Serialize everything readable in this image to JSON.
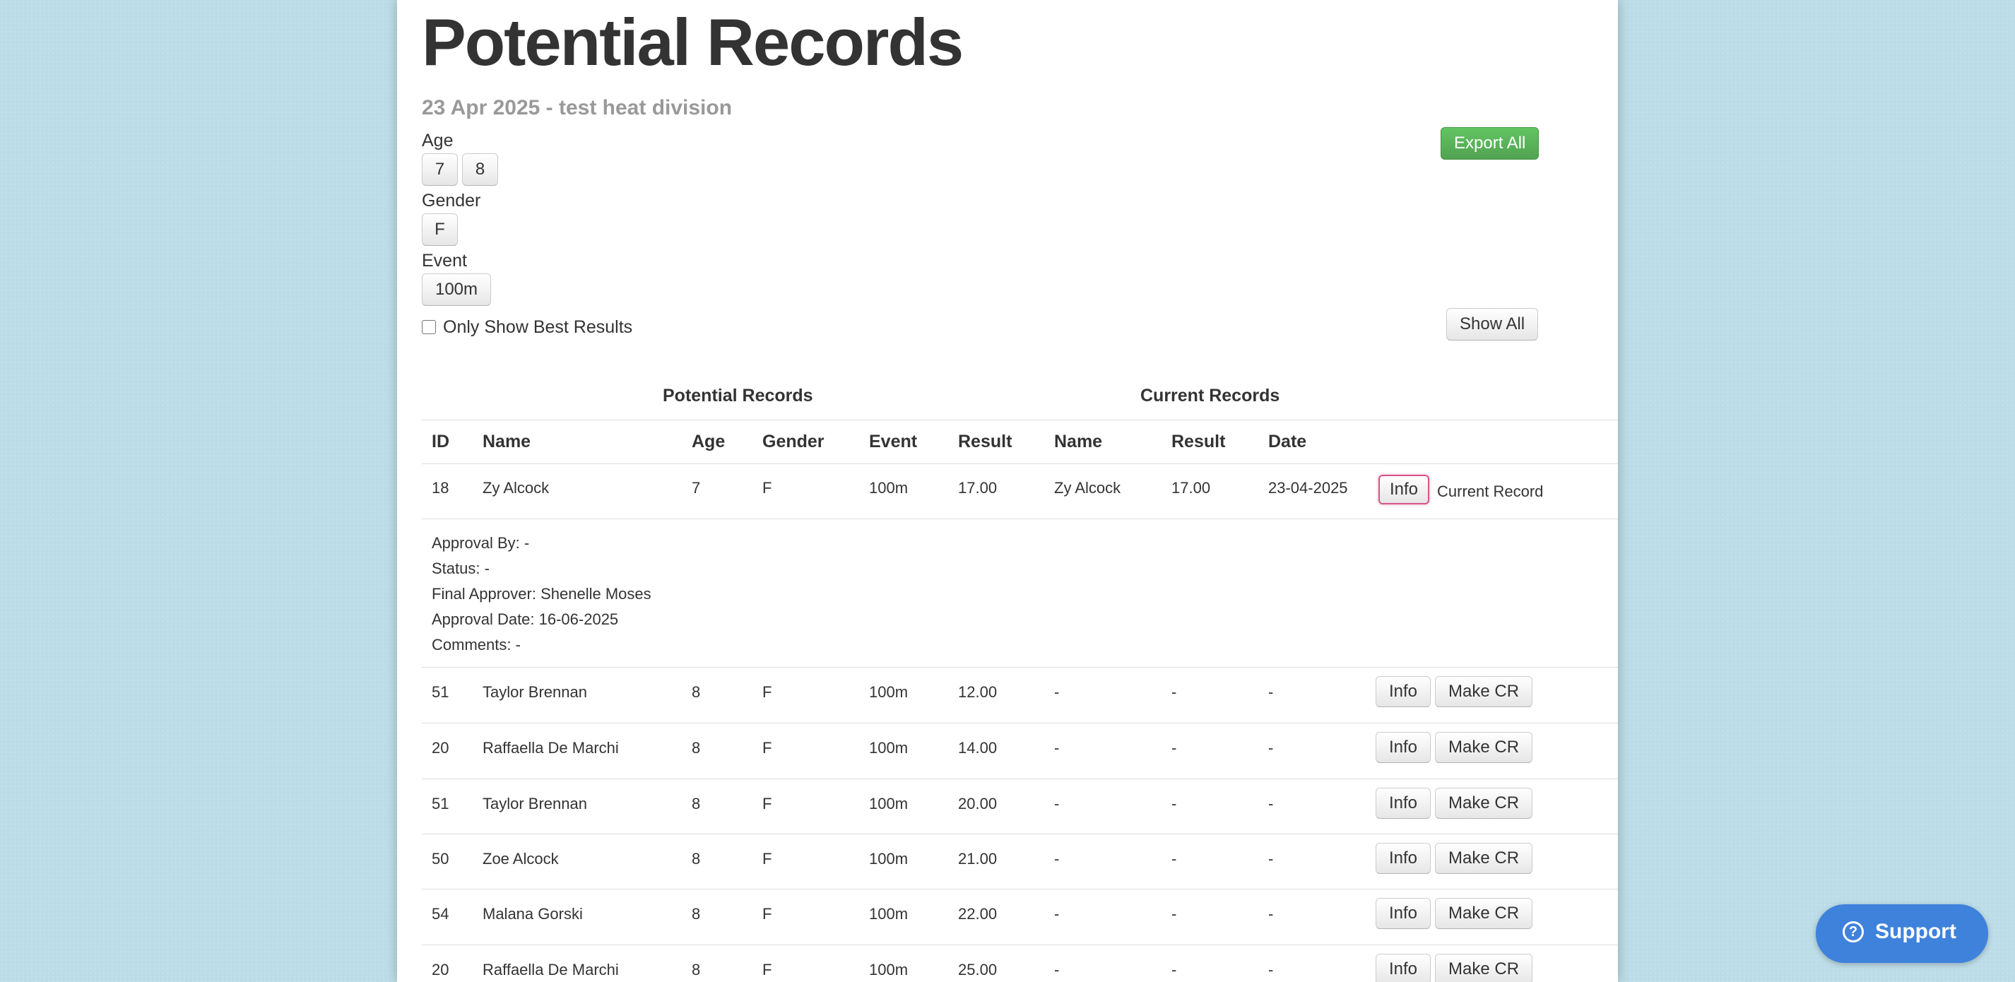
{
  "page": {
    "title": "Potential Records",
    "subtitle": "23 Apr 2025 - test heat division",
    "export_label": "Export All",
    "show_all_label": "Show All"
  },
  "filters": {
    "age": {
      "label": "Age",
      "options": [
        "7",
        "8"
      ]
    },
    "gender": {
      "label": "Gender",
      "options": [
        "F"
      ]
    },
    "event": {
      "label": "Event",
      "options": [
        "100m"
      ]
    },
    "best_only": {
      "label": "Only Show Best Results",
      "checked": false
    }
  },
  "table": {
    "group_headers": [
      "Potential Records",
      "Current Records"
    ],
    "columns": [
      "ID",
      "Name",
      "Age",
      "Gender",
      "Event",
      "Result",
      "Name",
      "Result",
      "Date"
    ],
    "info_label": "Info",
    "make_cr_label": "Make CR",
    "current_record_label": "Current Record",
    "rows": [
      {
        "id": "18",
        "name": "Zy Alcock",
        "age": "7",
        "gender": "F",
        "event": "100m",
        "result": "17.00",
        "cr_name": "Zy Alcock",
        "cr_result": "17.00",
        "cr_date": "23-04-2025",
        "is_current": true
      },
      {
        "id": "51",
        "name": "Taylor Brennan",
        "age": "8",
        "gender": "F",
        "event": "100m",
        "result": "12.00",
        "cr_name": "-",
        "cr_result": "-",
        "cr_date": "-",
        "is_current": false
      },
      {
        "id": "20",
        "name": "Raffaella De Marchi",
        "age": "8",
        "gender": "F",
        "event": "100m",
        "result": "14.00",
        "cr_name": "-",
        "cr_result": "-",
        "cr_date": "-",
        "is_current": false
      },
      {
        "id": "51",
        "name": "Taylor Brennan",
        "age": "8",
        "gender": "F",
        "event": "100m",
        "result": "20.00",
        "cr_name": "-",
        "cr_result": "-",
        "cr_date": "-",
        "is_current": false
      },
      {
        "id": "50",
        "name": "Zoe Alcock",
        "age": "8",
        "gender": "F",
        "event": "100m",
        "result": "21.00",
        "cr_name": "-",
        "cr_result": "-",
        "cr_date": "-",
        "is_current": false
      },
      {
        "id": "54",
        "name": "Malana Gorski",
        "age": "8",
        "gender": "F",
        "event": "100m",
        "result": "22.00",
        "cr_name": "-",
        "cr_result": "-",
        "cr_date": "-",
        "is_current": false
      },
      {
        "id": "20",
        "name": "Raffaella De Marchi",
        "age": "8",
        "gender": "F",
        "event": "100m",
        "result": "25.00",
        "cr_name": "-",
        "cr_result": "-",
        "cr_date": "-",
        "is_current": false
      }
    ],
    "detail": [
      "Approval By: -",
      "Status: -",
      "Final Approver: Shenelle Moses",
      "Approval Date: 16-06-2025",
      "Comments: -"
    ]
  },
  "support": {
    "label": "Support",
    "icon": "question-circle-icon",
    "color": "#3f82dc"
  }
}
